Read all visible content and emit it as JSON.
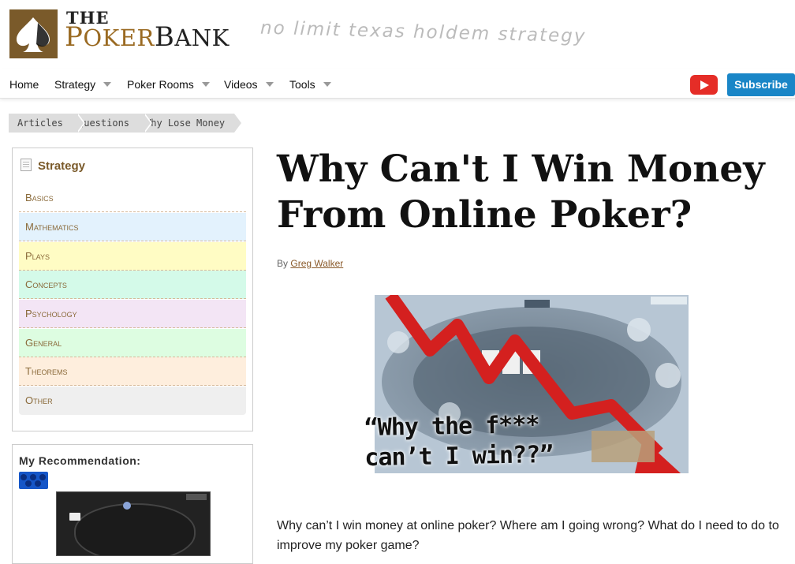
{
  "brand": {
    "the": "THE",
    "poker_p": "P",
    "poker_rest": "OKER",
    "bank": "BANK",
    "tagline": "no limit texas holdem strategy"
  },
  "nav": {
    "items": [
      {
        "label": "Home"
      },
      {
        "label": "Strategy"
      },
      {
        "label": "Poker Rooms"
      },
      {
        "label": "Videos"
      },
      {
        "label": "Tools"
      }
    ],
    "subscribe": "Subscribe"
  },
  "breadcrumb": [
    "Articles",
    "Questions",
    "Why Lose Money"
  ],
  "sidebar": {
    "heading": "Strategy",
    "categories": [
      {
        "label": "Basics",
        "color": "#ffffff"
      },
      {
        "label": "Mathematics",
        "color": "#e3f2fd"
      },
      {
        "label": "Plays",
        "color": "#fffcc4"
      },
      {
        "label": "Concepts",
        "color": "#d4fae9"
      },
      {
        "label": "Psychology",
        "color": "#f3e5f5"
      },
      {
        "label": "General",
        "color": "#ddfde1"
      },
      {
        "label": "Theorems",
        "color": "#feeedd"
      },
      {
        "label": "Other",
        "color": "#efefef"
      }
    ],
    "recommendation_heading": "My Recommendation:"
  },
  "article": {
    "title": "Why Can't I Win Money From Online Poker?",
    "by": "By",
    "author": "Greg Walker",
    "image_caption_line1": "“Why the f*** ",
    "image_caption_line2": "can’t I win??”",
    "intro": "Why can’t I win money at online poker? Where am I going wrong? What do I need to do to improve my poker game?"
  }
}
